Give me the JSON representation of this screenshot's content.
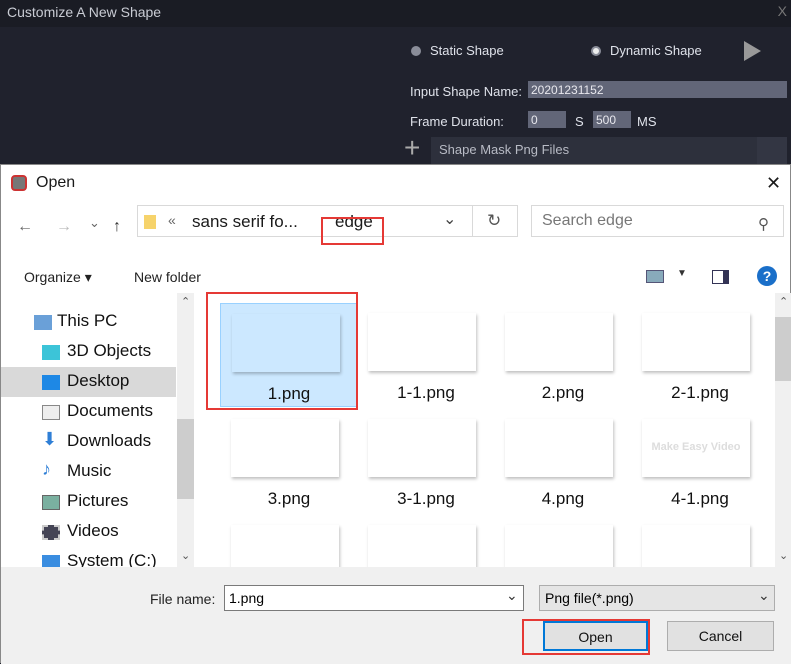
{
  "app": {
    "title": "Customize A New Shape",
    "close": "X",
    "static_label": "Static Shape",
    "dynamic_label": "Dynamic Shape",
    "name_label": "Input Shape Name:",
    "name_value": "20201231152",
    "duration_label": "Frame Duration:",
    "seconds_value": "0",
    "seconds_unit": "S",
    "ms_value": "500",
    "ms_unit": "MS",
    "files_header": "Shape Mask Png Files",
    "add": "+"
  },
  "dialog": {
    "title": "Open",
    "close": "✕",
    "nav": {
      "back": "←",
      "forward": "→",
      "recent": "⌄",
      "up": "↑",
      "crumb_sep": "«",
      "crumb1": "sans serif fo...",
      "crumb2": "edge",
      "refresh": "↻"
    },
    "search_placeholder": "Search edge",
    "toolbar": {
      "organize": "Organize ▾",
      "new_folder": "New folder",
      "help": "?"
    },
    "sidebar": [
      {
        "label": "This PC"
      },
      {
        "label": "3D Objects"
      },
      {
        "label": "Desktop",
        "selected": true
      },
      {
        "label": "Documents"
      },
      {
        "label": "Downloads"
      },
      {
        "label": "Music"
      },
      {
        "label": "Pictures"
      },
      {
        "label": "Videos"
      },
      {
        "label": "System (C:)"
      }
    ],
    "files": [
      {
        "name": "1.png",
        "selected": true
      },
      {
        "name": "1-1.png"
      },
      {
        "name": "2.png"
      },
      {
        "name": "2-1.png"
      },
      {
        "name": "3.png"
      },
      {
        "name": "3-1.png"
      },
      {
        "name": "4.png"
      },
      {
        "name": "4-1.png",
        "thumb_text": "Make Easy Video"
      }
    ],
    "file_name_label": "File name:",
    "file_name_value": "1.png",
    "file_type": "Png file(*.png)",
    "open": "Open",
    "cancel": "Cancel"
  },
  "colors": {
    "highlight": "#e53935",
    "selection": "#cce8ff",
    "app_bg": "#20222d"
  }
}
